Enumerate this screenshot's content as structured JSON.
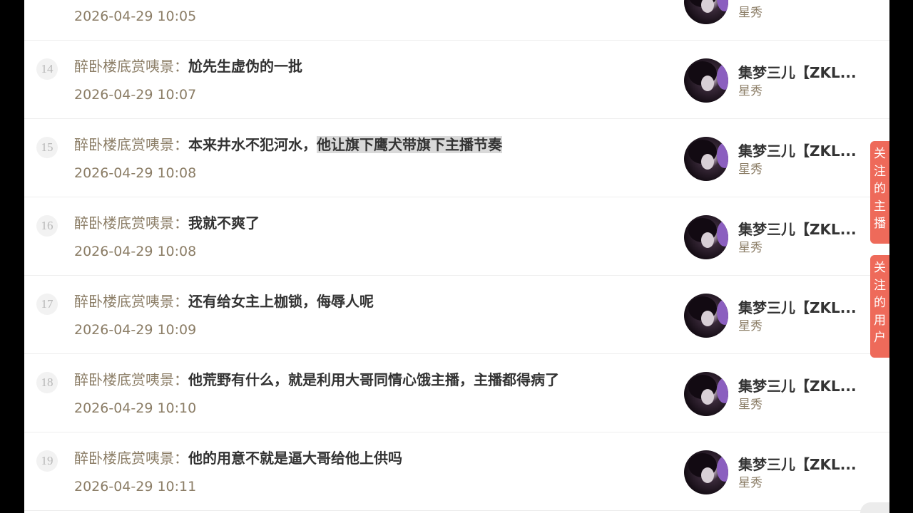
{
  "comments": [
    {
      "index": "",
      "sender": "",
      "content": "",
      "time": "2026-04-29 10:05",
      "user_name": "",
      "user_type": "星秀",
      "partial": true
    },
    {
      "index": "14",
      "sender": "醉卧楼底赏咦景：",
      "content": "尬先生虚伪的一批",
      "time": "2026-04-29 10:07",
      "user_name": "集梦三儿【ZKL...",
      "user_type": "星秀"
    },
    {
      "index": "15",
      "sender": "醉卧楼底赏咦景：",
      "content_plain": "本来井水不犯河水，",
      "content_highlight": "他让旗下鹰犬带旗下主播节奏",
      "time": "2026-04-29 10:08",
      "user_name": "集梦三儿【ZKL...",
      "user_type": "星秀"
    },
    {
      "index": "16",
      "sender": "醉卧楼底赏咦景：",
      "content": "我就不爽了",
      "time": "2026-04-29 10:08",
      "user_name": "集梦三儿【ZKL...",
      "user_type": "星秀"
    },
    {
      "index": "17",
      "sender": "醉卧楼底赏咦景：",
      "content": "还有给女主上枷锁，侮辱人呢",
      "time": "2026-04-29 10:09",
      "user_name": "集梦三儿【ZKL...",
      "user_type": "星秀"
    },
    {
      "index": "18",
      "sender": "醉卧楼底赏咦景：",
      "content": "他荒野有什么，就是利用大哥同情心饿主播，主播都得病了",
      "time": "2026-04-29 10:10",
      "user_name": "集梦三儿【ZKL...",
      "user_type": "星秀"
    },
    {
      "index": "19",
      "sender": "醉卧楼底赏咦景：",
      "content": "他的用意不就是逼大哥给他上供吗",
      "time": "2026-04-29 10:11",
      "user_name": "集梦三儿【ZKL...",
      "user_type": "星秀"
    }
  ],
  "side_buttons": {
    "followed_streamers": [
      "关",
      "注",
      "的",
      "主",
      "播"
    ],
    "followed_users": [
      "关",
      "注",
      "的",
      "用",
      "户"
    ]
  },
  "colors": {
    "accent": "#ee6a5a",
    "sender_text": "#8b7d66",
    "content_text": "#333333"
  }
}
